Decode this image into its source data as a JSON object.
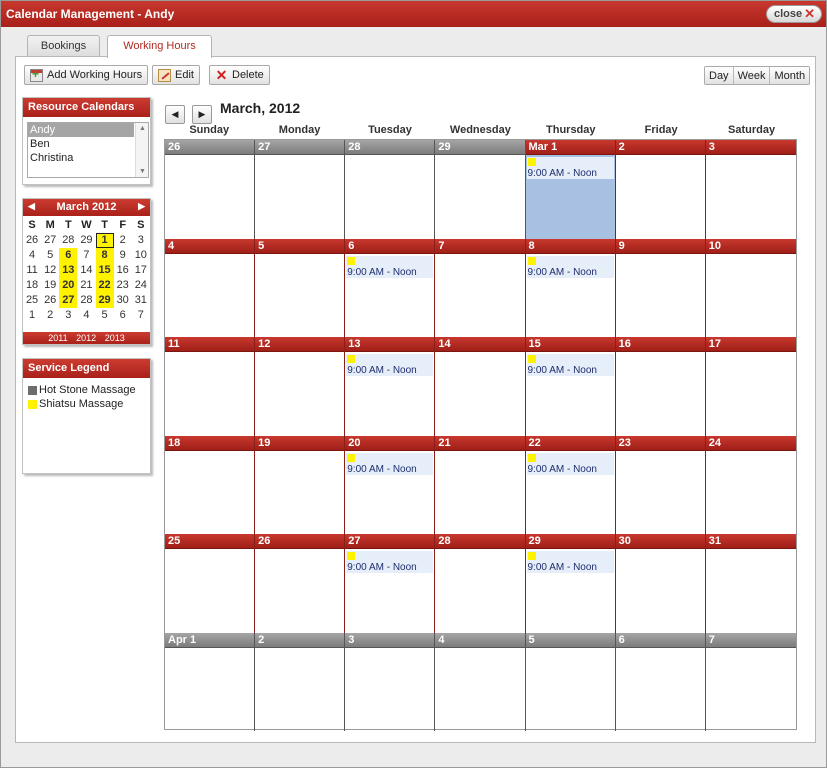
{
  "window": {
    "title": "Calendar Management - Andy",
    "close_label": "close",
    "close_glyph": "✕"
  },
  "tabs": [
    {
      "label": "Bookings",
      "active": false
    },
    {
      "label": "Working Hours",
      "active": true
    }
  ],
  "toolbar": {
    "add_label": "Add Working Hours",
    "edit_label": "Edit",
    "delete_label": "Delete",
    "delete_glyph": "✕",
    "views": [
      "Day",
      "Week",
      "Month"
    ]
  },
  "resource_calendars": {
    "title": "Resource Calendars",
    "items": [
      "Andy",
      "Ben",
      "Christina"
    ],
    "selected": "Andy"
  },
  "mini_calendar": {
    "title": "March 2012",
    "prev_glyph": "◀",
    "next_glyph": "▶",
    "dow": [
      "S",
      "M",
      "T",
      "W",
      "T",
      "F",
      "S"
    ],
    "weeks": [
      [
        "26",
        "27",
        "28",
        "29",
        "1",
        "2",
        "3"
      ],
      [
        "4",
        "5",
        "6",
        "7",
        "8",
        "9",
        "10"
      ],
      [
        "11",
        "12",
        "13",
        "14",
        "15",
        "16",
        "17"
      ],
      [
        "18",
        "19",
        "20",
        "21",
        "22",
        "23",
        "24"
      ],
      [
        "25",
        "26",
        "27",
        "28",
        "29",
        "30",
        "31"
      ],
      [
        "1",
        "2",
        "3",
        "4",
        "5",
        "6",
        "7"
      ]
    ],
    "highlighted": [
      "0-4",
      "1-2",
      "1-4",
      "2-2",
      "2-4",
      "3-2",
      "3-4",
      "4-2",
      "4-4"
    ],
    "today": "0-4",
    "years": [
      "2011",
      "2012",
      "2013"
    ]
  },
  "legend": {
    "title": "Service Legend",
    "items": [
      {
        "label": "Hot Stone Massage",
        "color": "#6d6d6d"
      },
      {
        "label": "Shiatsu Massage",
        "color": "#fff200"
      }
    ]
  },
  "calendar": {
    "title": "March, 2012",
    "prev_glyph": "◀",
    "next_glyph": "▶",
    "dow": [
      "Sunday",
      "Monday",
      "Tuesday",
      "Wednesday",
      "Thursday",
      "Friday",
      "Saturday"
    ],
    "weeks": [
      [
        {
          "label": "26",
          "other": true
        },
        {
          "label": "27",
          "other": true
        },
        {
          "label": "28",
          "other": true
        },
        {
          "label": "29",
          "other": true
        },
        {
          "label": "Mar 1",
          "event": "9:00 AM - Noon",
          "selected": true
        },
        {
          "label": "2"
        },
        {
          "label": "3"
        }
      ],
      [
        {
          "label": "4"
        },
        {
          "label": "5"
        },
        {
          "label": "6",
          "event": "9:00 AM - Noon"
        },
        {
          "label": "7"
        },
        {
          "label": "8",
          "event": "9:00 AM - Noon"
        },
        {
          "label": "9"
        },
        {
          "label": "10"
        }
      ],
      [
        {
          "label": "11"
        },
        {
          "label": "12"
        },
        {
          "label": "13",
          "event": "9:00 AM - Noon"
        },
        {
          "label": "14"
        },
        {
          "label": "15",
          "event": "9:00 AM - Noon"
        },
        {
          "label": "16"
        },
        {
          "label": "17"
        }
      ],
      [
        {
          "label": "18"
        },
        {
          "label": "19"
        },
        {
          "label": "20",
          "event": "9:00 AM - Noon"
        },
        {
          "label": "21"
        },
        {
          "label": "22",
          "event": "9:00 AM - Noon"
        },
        {
          "label": "23"
        },
        {
          "label": "24"
        }
      ],
      [
        {
          "label": "25"
        },
        {
          "label": "26"
        },
        {
          "label": "27",
          "event": "9:00 AM - Noon"
        },
        {
          "label": "28"
        },
        {
          "label": "29",
          "event": "9:00 AM - Noon"
        },
        {
          "label": "30"
        },
        {
          "label": "31"
        }
      ],
      [
        {
          "label": "Apr 1",
          "other": true
        },
        {
          "label": "2",
          "other": true
        },
        {
          "label": "3",
          "other": true
        },
        {
          "label": "4",
          "other": true
        },
        {
          "label": "5",
          "other": true
        },
        {
          "label": "6",
          "other": true
        },
        {
          "label": "7",
          "other": true
        }
      ]
    ],
    "event_color": "#fff200"
  }
}
